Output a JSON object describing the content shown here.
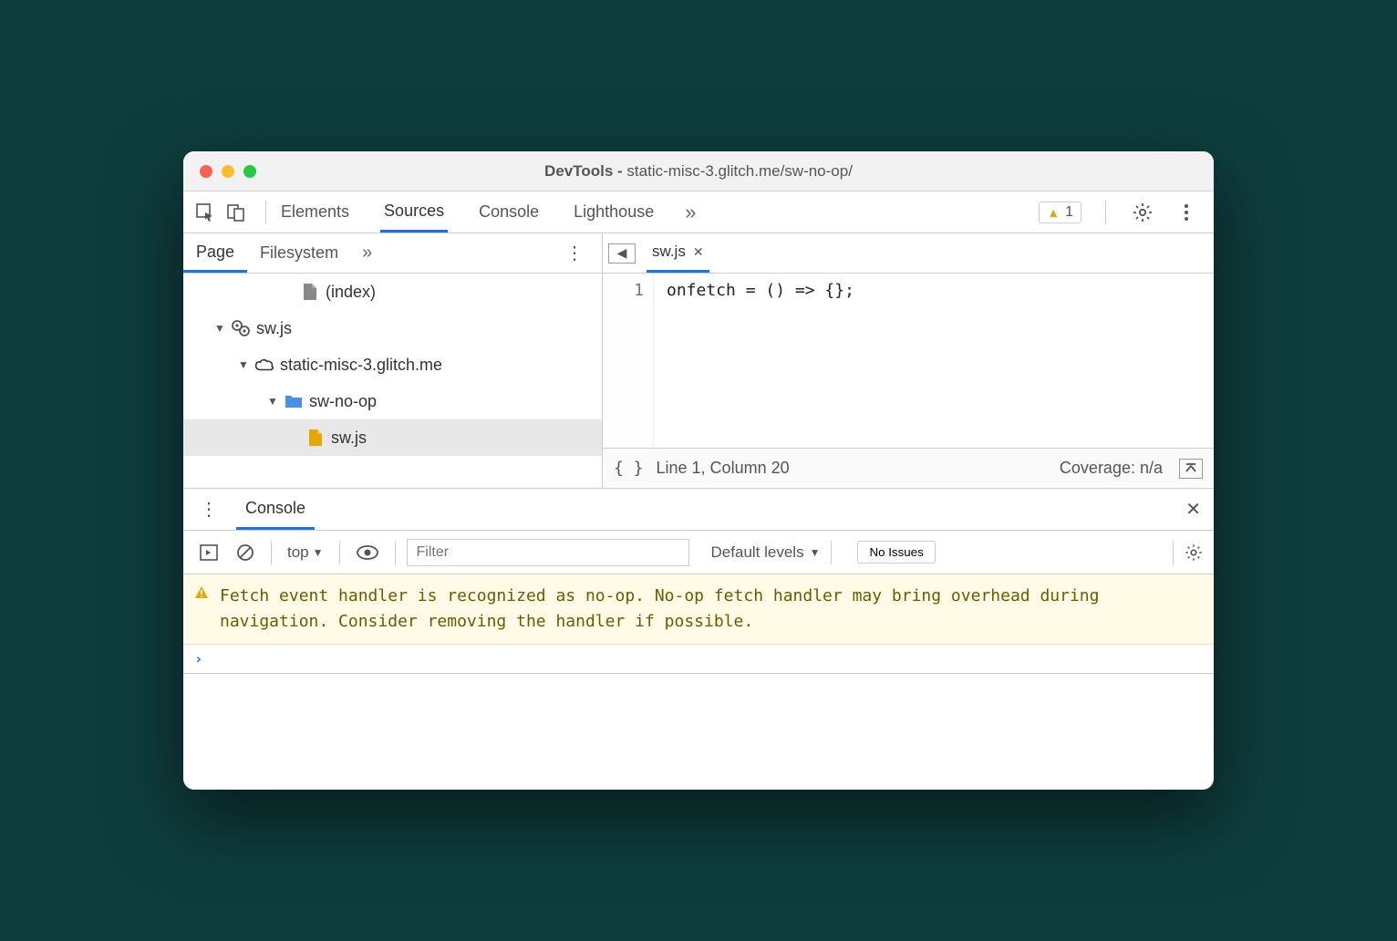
{
  "window": {
    "title_prefix": "DevTools - ",
    "title_host": "static-misc-3.glitch.me/sw-no-op/"
  },
  "toolbar": {
    "tabs": [
      "Elements",
      "Sources",
      "Console",
      "Lighthouse"
    ],
    "active_tab_index": 1,
    "warning_count": "1"
  },
  "sources": {
    "nav_tabs": [
      "Page",
      "Filesystem"
    ],
    "active_nav_tab": 0,
    "tree": {
      "index_label": "(index)",
      "sw_root": "sw.js",
      "domain": "static-misc-3.glitch.me",
      "folder": "sw-no-op",
      "selected_file": "sw.js"
    },
    "editor": {
      "open_file": "sw.js",
      "line_number": "1",
      "code_line": "onfetch = () => {};"
    },
    "statusbar": {
      "braces": "{ }",
      "position": "Line 1, Column 20",
      "coverage": "Coverage: n/a"
    }
  },
  "console": {
    "drawer_tab": "Console",
    "context": "top",
    "filter_placeholder": "Filter",
    "levels_label": "Default levels",
    "issues_button": "No Issues",
    "warning_message": "Fetch event handler is recognized as no-op. No-op fetch handler may bring overhead during navigation. Consider removing the handler if possible."
  }
}
